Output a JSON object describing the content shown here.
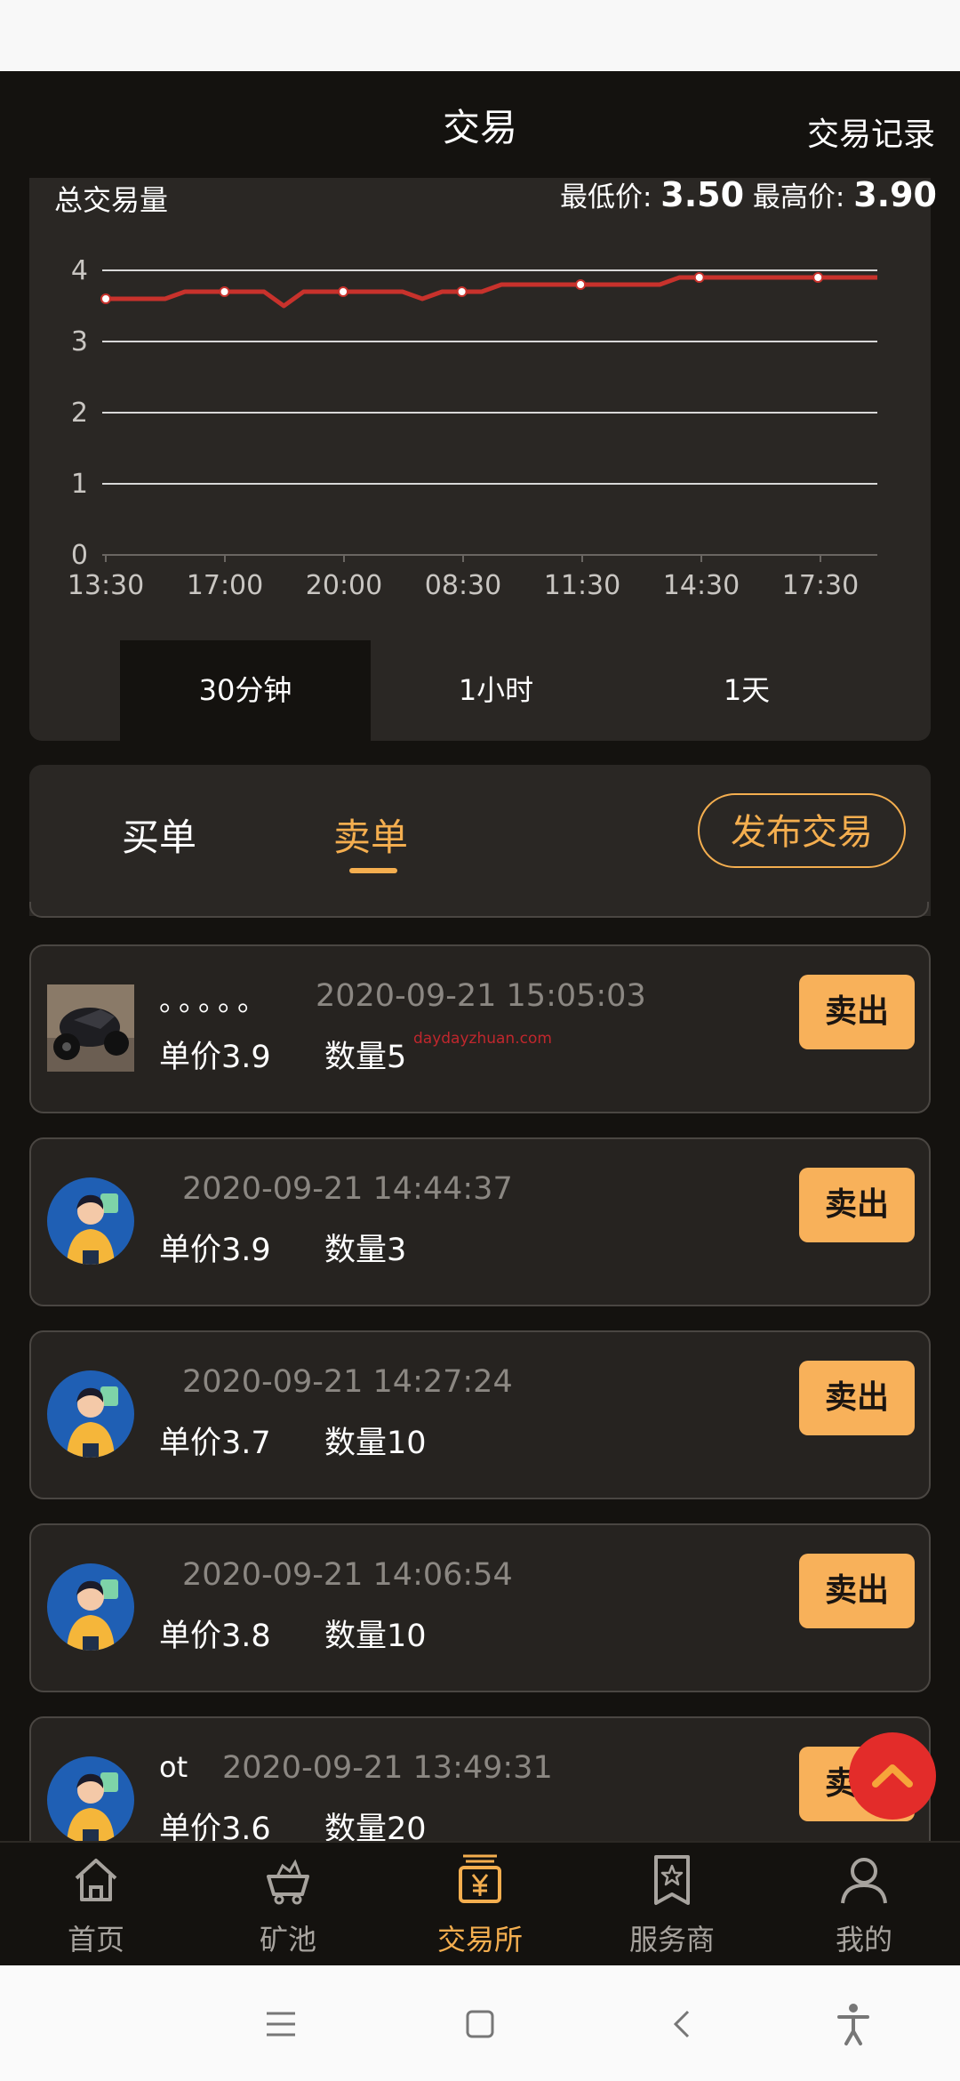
{
  "header": {
    "title": "交易",
    "history_link": "交易记录"
  },
  "chart_panel": {
    "label": "总交易量",
    "min_label": "最低价:",
    "min_value": "3.50",
    "max_label": "最高价:",
    "max_value": "3.90"
  },
  "chart_data": {
    "type": "line",
    "x_ticks": [
      "13:30",
      "17:00",
      "20:00",
      "08:30",
      "11:30",
      "14:30",
      "17:30"
    ],
    "y_ticks": [
      "0",
      "1",
      "2",
      "3",
      "4"
    ],
    "ylim": [
      0,
      4
    ],
    "grid": true,
    "color": "#c8322c",
    "values": [
      3.6,
      3.6,
      3.6,
      3.6,
      3.7,
      3.7,
      3.7,
      3.7,
      3.7,
      3.5,
      3.7,
      3.7,
      3.7,
      3.7,
      3.7,
      3.7,
      3.6,
      3.7,
      3.7,
      3.7,
      3.8,
      3.8,
      3.8,
      3.8,
      3.8,
      3.8,
      3.8,
      3.8,
      3.8,
      3.9,
      3.9,
      3.9,
      3.9,
      3.9,
      3.9,
      3.9,
      3.9,
      3.9,
      3.9,
      3.9
    ],
    "marker_indices": [
      0,
      6,
      12,
      18,
      24,
      30,
      36
    ]
  },
  "timeframes": {
    "items": [
      "30分钟",
      "1小时",
      "1天"
    ],
    "active_index": 0
  },
  "orders_panel": {
    "buy_tab": "买单",
    "sell_tab": "卖单",
    "active_tab": "sell",
    "publish_button": "发布交易"
  },
  "orders": [
    {
      "name": "。。。。。",
      "time": "2020-09-21 15:05:03",
      "price": "单价3.9",
      "qty": "数量5",
      "action": "卖出",
      "avatar": "motorcycle-photo"
    },
    {
      "name": "",
      "time": "2020-09-21 14:44:37",
      "price": "单价3.9",
      "qty": "数量3",
      "action": "卖出",
      "avatar": "cartoon-woman"
    },
    {
      "name": "",
      "time": "2020-09-21 14:27:24",
      "price": "单价3.7",
      "qty": "数量10",
      "action": "卖出",
      "avatar": "cartoon-woman"
    },
    {
      "name": "",
      "time": "2020-09-21 14:06:54",
      "price": "单价3.8",
      "qty": "数量10",
      "action": "卖出",
      "avatar": "cartoon-woman"
    },
    {
      "name": "ot",
      "time": "2020-09-21 13:49:31",
      "price": "单价3.6",
      "qty": "数量20",
      "action": "卖出",
      "avatar": "cartoon-woman"
    }
  ],
  "watermark": "daydayzhuan.com",
  "bottom_nav": {
    "items": [
      {
        "label": "首页",
        "icon": "home-icon"
      },
      {
        "label": "矿池",
        "icon": "mining-cart-icon"
      },
      {
        "label": "交易所",
        "icon": "exchange-yen-icon"
      },
      {
        "label": "服务商",
        "icon": "service-badge-icon"
      },
      {
        "label": "我的",
        "icon": "profile-icon"
      }
    ],
    "active_index": 2
  },
  "colors": {
    "accent": "#f4ae4f",
    "chart_line": "#c8322c",
    "scroll_top_button": "#e32c2a"
  }
}
